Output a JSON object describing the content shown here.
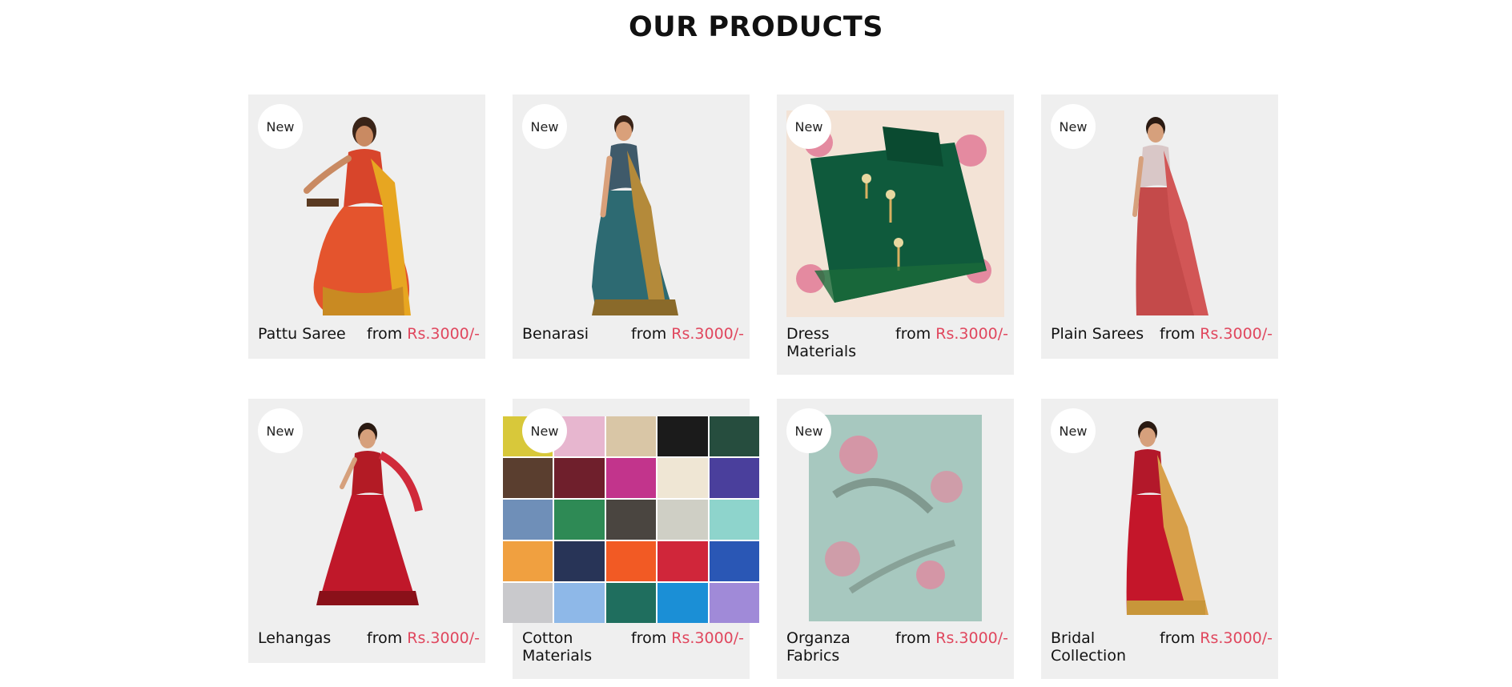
{
  "heading": "OUR PRODUCTS",
  "badge": "New",
  "from_label": "from",
  "products": [
    {
      "name": "Pattu Saree",
      "price": "Rs.3000/-"
    },
    {
      "name": "Benarasi",
      "price": "Rs.3000/-"
    },
    {
      "name": "Dress Materials",
      "price": "Rs.3000/-"
    },
    {
      "name": "Plain Sarees",
      "price": "Rs.3000/-"
    },
    {
      "name": "Lehangas",
      "price": "Rs.3000/-"
    },
    {
      "name": "Cotton Materials",
      "price": "Rs.3000/-"
    },
    {
      "name": "Organza Fabrics",
      "price": "Rs.3000/-"
    },
    {
      "name": "Bridal Collection",
      "price": "Rs.3000/-"
    }
  ],
  "colors": {
    "card_bg": "#efefef",
    "price_accent": "#e0475e",
    "cotton_swatches": [
      "#d8c83a",
      "#e7b6cf",
      "#d9c6a6",
      "#1b1b1b",
      "#264d3e",
      "#5a3e2f",
      "#6f1f2c",
      "#c2348c",
      "#efe6d4",
      "#4a3f9c",
      "#6f8fb8",
      "#2e8a55",
      "#4a4540",
      "#cfcfc5",
      "#8ed4cc",
      "#f0a040",
      "#283457",
      "#f25a24",
      "#d0263a",
      "#2a57b5",
      "#c9c9cc",
      "#8eb8e8",
      "#1f6e5e",
      "#1b8fd6",
      "#a08ad8"
    ]
  }
}
